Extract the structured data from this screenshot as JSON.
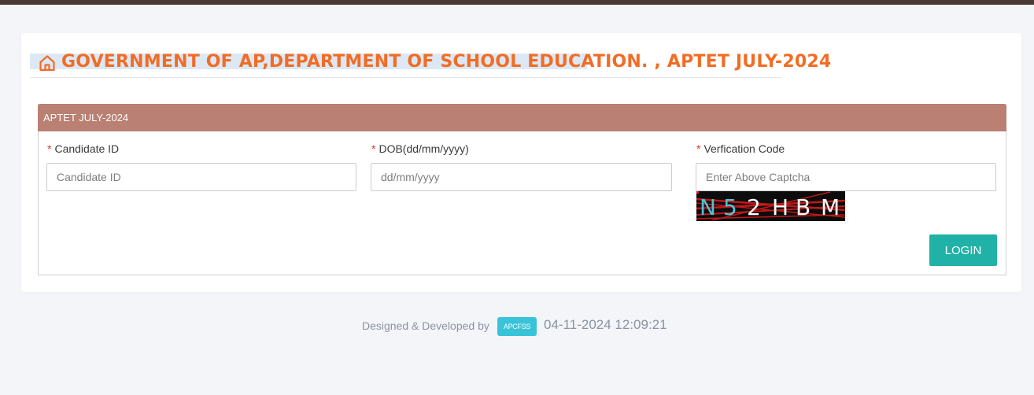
{
  "header": {
    "title": "GOVERNMENT OF AP,DEPARTMENT OF SCHOOL EDUCATION. , APTET JULY-2024",
    "icon": "home-icon",
    "accent_color": "#f26c24"
  },
  "panel": {
    "heading": "APTET JULY-2024",
    "heading_color": "#b98073"
  },
  "form": {
    "required_marker": "*",
    "candidate_id": {
      "label": "Candidate ID",
      "placeholder": "Candidate ID",
      "value": ""
    },
    "dob": {
      "label": "DOB(dd/mm/yyyy)",
      "placeholder": "dd/mm/yyyy",
      "value": ""
    },
    "verification": {
      "label": "Verfication Code",
      "placeholder": "Enter Above Captcha",
      "value": ""
    },
    "captcha_text": [
      "N",
      "5",
      "2",
      "H",
      "B",
      "M"
    ],
    "login_label": "LOGIN",
    "login_color": "#20b2a6"
  },
  "footer": {
    "text": "Designed & Developed by",
    "badge": "APCFSS",
    "timestamp": "04-11-2024 12:09:21"
  }
}
